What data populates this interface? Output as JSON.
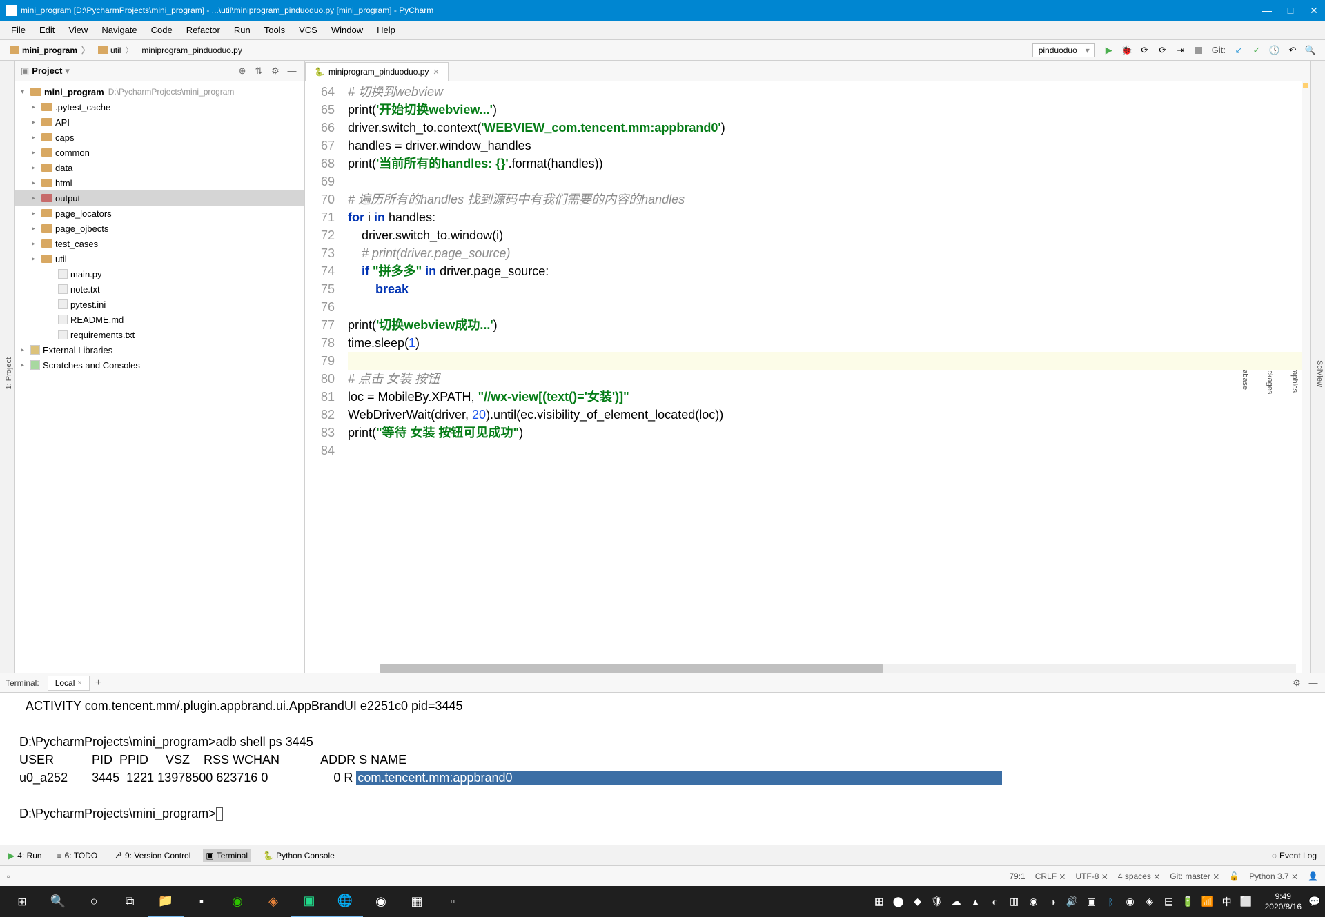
{
  "titlebar": {
    "text": "mini_program [D:\\PycharmProjects\\mini_program] - ...\\util\\miniprogram_pinduoduo.py [mini_program] - PyCharm"
  },
  "menubar": [
    "File",
    "Edit",
    "View",
    "Navigate",
    "Code",
    "Refactor",
    "Run",
    "Tools",
    "VCS",
    "Window",
    "Help"
  ],
  "breadcrumbs": {
    "project": "mini_program",
    "folder": "util",
    "file": "miniprogram_pinduoduo.py"
  },
  "navbar": {
    "run_config": "pinduoduo",
    "git_label": "Git:"
  },
  "project_panel": {
    "title": "Project",
    "root": "mini_program",
    "root_path": "D:\\PycharmProjects\\mini_program",
    "folders": [
      ".pytest_cache",
      "API",
      "caps",
      "common",
      "data",
      "html",
      "output",
      "page_locators",
      "page_ojbects",
      "test_cases",
      "util"
    ],
    "files": [
      "main.py",
      "note.txt",
      "pytest.ini",
      "README.md",
      "requirements.txt"
    ],
    "external": "External Libraries",
    "scratches": "Scratches and Consoles"
  },
  "editor": {
    "tab": "miniprogram_pinduoduo.py",
    "lines": [
      64,
      65,
      66,
      67,
      68,
      69,
      70,
      71,
      72,
      73,
      74,
      75,
      76,
      77,
      78,
      79,
      80,
      81,
      82,
      83,
      84
    ]
  },
  "terminal": {
    "title": "Terminal:",
    "tab": "Local",
    "line1": "  ACTIVITY com.tencent.mm/.plugin.appbrand.ui.AppBrandUI e2251c0 pid=3445",
    "prompt1": "D:\\PycharmProjects\\mini_program>",
    "cmd1": "adb shell ps 3445",
    "header": "USER           PID  PPID     VSZ    RSS WCHAN            ADDR S NAME",
    "row_pre": "u0_a252       3445  1221 13978500 623716 0                   0 R ",
    "row_hl": "com.tencent.mm:appbrand0",
    "prompt2": "D:\\PycharmProjects\\mini_program>"
  },
  "bottom": {
    "run": "4: Run",
    "todo": "6: TODO",
    "vcs": "9: Version Control",
    "terminal": "Terminal",
    "console": "Python Console",
    "event": "Event Log"
  },
  "status": {
    "pos": "79:1",
    "le": "CRLF",
    "enc": "UTF-8",
    "indent": "4 spaces",
    "git": "Git: master",
    "py": "Python 3.7"
  },
  "taskbar": {
    "time": "9:49",
    "date": "2020/8/16"
  }
}
